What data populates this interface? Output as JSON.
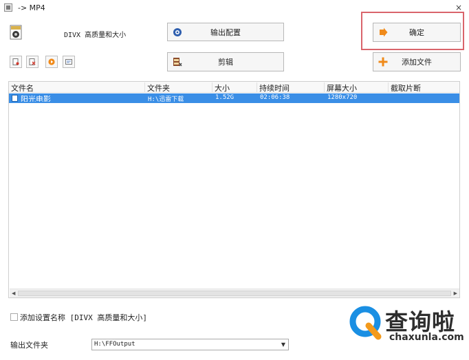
{
  "window": {
    "title": "-> MP4",
    "close_glyph": "×"
  },
  "profile": {
    "icon": "mp4-file-icon",
    "label": "DIVX 高质量和大小"
  },
  "buttons": {
    "output_config": "输出配置",
    "edit": "剪辑",
    "confirm": "确定",
    "add_file": "添加文件"
  },
  "toolbar": [
    "file-options-icon",
    "remove-file-icon",
    "play-icon",
    "file-info-icon"
  ],
  "table": {
    "columns": [
      "文件名",
      "文件夹",
      "大小",
      "持续时间",
      "屏幕大小",
      "截取片断"
    ],
    "rows": [
      {
        "name": "阳光电影",
        "folder": "H:\\迅雷下载",
        "size": "1.52G",
        "duration": "02:06:38",
        "resolution": "1280x720",
        "clip": ""
      }
    ]
  },
  "options": {
    "add_setting_name": "添加设置名称 [DIVX 高质量和大小]",
    "add_setting_checked": false
  },
  "output": {
    "label": "输出文件夹",
    "folder": "H:\\FFOutput"
  },
  "watermark": {
    "text_cn": "查询啦",
    "text_en": "chaxunla.com",
    "brand_colors": [
      "#1a8fe3",
      "#f39a1c"
    ]
  },
  "colors": {
    "selection": "#3a8ee6",
    "highlight_frame": "#d9646b",
    "add_icon": "#f08a1a"
  }
}
